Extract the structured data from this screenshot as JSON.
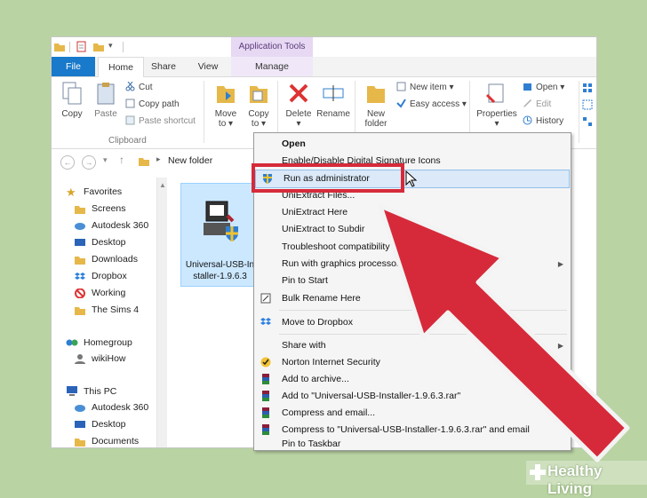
{
  "title_bar": {
    "app_tools": "Application Tools"
  },
  "tabs": [
    {
      "label": "File"
    },
    {
      "label": "Home"
    },
    {
      "label": "Share"
    },
    {
      "label": "View"
    },
    {
      "label": "Manage"
    }
  ],
  "ribbon": {
    "copy": "Copy",
    "paste": "Paste",
    "cut": "Cut",
    "copy_path": "Copy path",
    "paste_shortcut": "Paste shortcut",
    "clipboard_group": "Clipboard",
    "move_to_1": "Move",
    "move_to_2": "to",
    "copy_to_1": "Copy",
    "copy_to_2": "to",
    "delete": "Delete",
    "rename": "Rename",
    "new_folder_1": "New",
    "new_folder_2": "folder",
    "new_item": "New item",
    "easy_access": "Easy access",
    "properties": "Properties",
    "open": "Open",
    "edit": "Edit",
    "history": "History"
  },
  "address": {
    "path": "New folder"
  },
  "nav": {
    "favorites": "Favorites",
    "favorites_items": [
      "Screens",
      "Autodesk 360",
      "Desktop",
      "Downloads",
      "Dropbox",
      "Working",
      "The Sims 4"
    ],
    "homegroup": "Homegroup",
    "wikihow": "wikiHow",
    "this_pc": "This PC",
    "pc_items": [
      "Autodesk 360",
      "Desktop",
      "Documents"
    ]
  },
  "file": {
    "name_line1": "Universal-USB-In",
    "name_line2": "staller-1.9.6.3"
  },
  "context_menu": {
    "items": [
      "Open",
      "Enable/Disable Digital Signature Icons",
      "Run as administrator",
      "UniExtract Files...",
      "UniExtract Here",
      "UniExtract to Subdir",
      "Troubleshoot compatibility",
      "Run with graphics processor",
      "Pin to Start",
      "Bulk Rename Here",
      "Move to Dropbox",
      "Share with",
      "Norton Internet Security",
      "Add to archive...",
      "Add to \"Universal-USB-Installer-1.9.6.3.rar\"",
      "Compress and email...",
      "Compress to \"Universal-USB-Installer-1.9.6.3.rar\" and email",
      "Pin to Taskbar"
    ]
  },
  "watermark": {
    "text": "Healthy Living"
  },
  "colors": {
    "accent": "#1979ca",
    "annotation_red": "#d62a3a",
    "background": "#b9d3a3"
  }
}
